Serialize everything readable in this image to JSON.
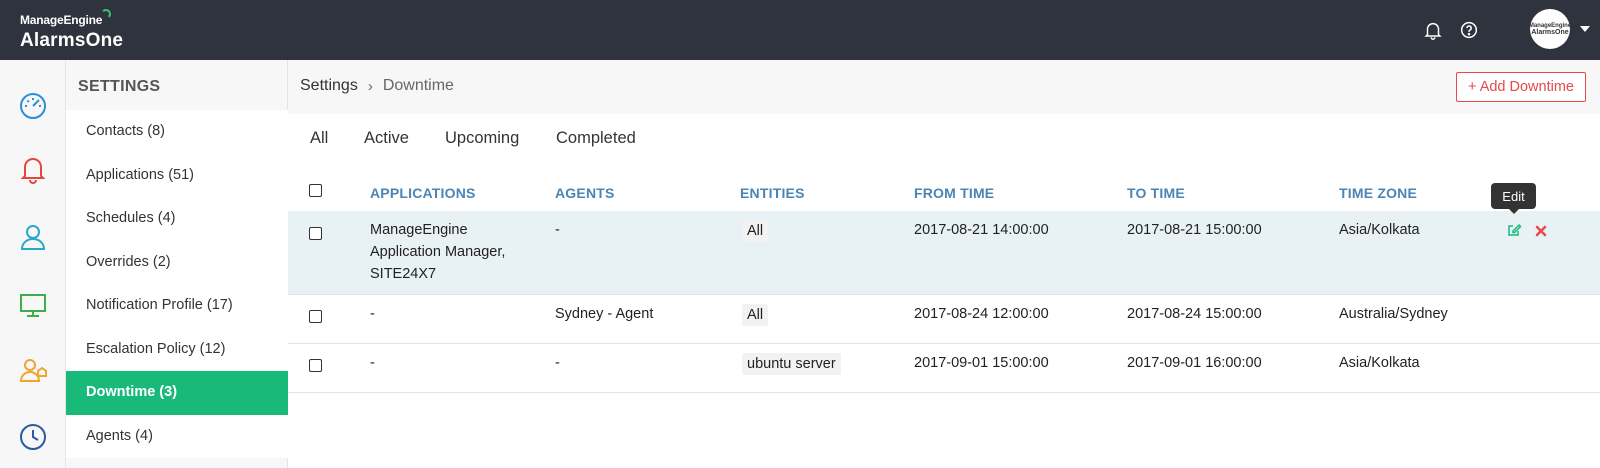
{
  "app": {
    "brand": "ManageEngine",
    "product": "AlarmsOne",
    "avatar_line1": "ManageEngine",
    "avatar_line2": "AlarmsOne"
  },
  "topbar_icons": [
    "bell-icon",
    "help-icon"
  ],
  "rail_icons": [
    "dashboard-gauge-icon",
    "alarm-bell-icon",
    "user-icon",
    "monitor-icon",
    "user-group-icon",
    "clock-icon"
  ],
  "settings": {
    "title": "SETTINGS",
    "items": [
      {
        "label": "Contacts (8)"
      },
      {
        "label": "Applications (51)"
      },
      {
        "label": "Schedules (4)"
      },
      {
        "label": "Overrides (2)"
      },
      {
        "label": "Notification Profile (17)"
      },
      {
        "label": "Escalation Policy (12)"
      },
      {
        "label": "Downtime (3)",
        "active": true
      },
      {
        "label": "Agents (4)"
      }
    ]
  },
  "breadcrumb": {
    "parent": "Settings",
    "separator": "›",
    "current": "Downtime"
  },
  "add_button": "+ Add Downtime",
  "tabs": [
    {
      "label": "All",
      "active": true
    },
    {
      "label": "Active"
    },
    {
      "label": "Upcoming"
    },
    {
      "label": "Completed"
    }
  ],
  "table": {
    "columns": [
      "APPLICATIONS",
      "AGENTS",
      "ENTITIES",
      "FROM TIME",
      "TO TIME",
      "TIME ZONE"
    ],
    "rows": [
      {
        "applications": [
          "ManageEngine",
          "Application Manager,",
          "SITE24X7"
        ],
        "agents": "-",
        "entities": "All",
        "from_time": "2017-08-21 14:00:00",
        "to_time": "2017-08-21 15:00:00",
        "time_zone": "Asia/Kolkata"
      },
      {
        "applications": [
          "-"
        ],
        "agents": "Sydney - Agent",
        "entities": "All",
        "from_time": "2017-08-24 12:00:00",
        "to_time": "2017-08-24 15:00:00",
        "time_zone": "Australia/Sydney"
      },
      {
        "applications": [
          "-"
        ],
        "agents": "-",
        "entities": "ubuntu server",
        "from_time": "2017-09-01 15:00:00",
        "to_time": "2017-09-01 16:00:00",
        "time_zone": "Asia/Kolkata"
      }
    ]
  },
  "tooltip": "Edit",
  "colors": {
    "topbar": "#2e333d",
    "accent_green": "#19b97a",
    "header_blue": "#4a85b6",
    "danger_red": "#e54b4b",
    "row_highlight": "#e8f1f4"
  }
}
